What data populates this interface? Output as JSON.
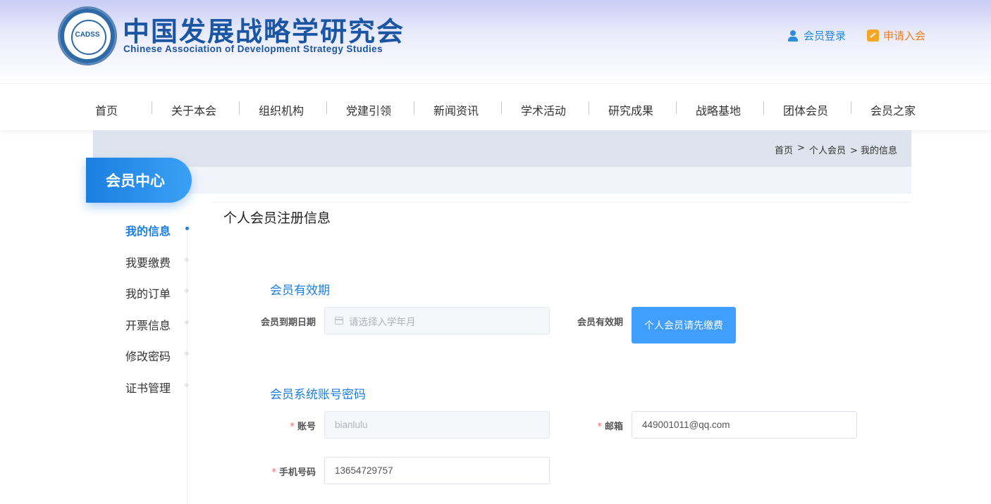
{
  "header": {
    "logo_text": "CADSS",
    "title": "中国发展战略学研究会",
    "subtitle": "Chinese Association of Development Strategy Studies",
    "login_label": "会员登录",
    "join_label": "申请入会"
  },
  "nav": {
    "items": [
      "首页",
      "关于本会",
      "组织机构",
      "党建引领",
      "新闻资讯",
      "学术活动",
      "研究成果",
      "战略基地",
      "团体会员",
      "会员之家"
    ]
  },
  "breadcrumb": {
    "items": [
      "首页",
      ">",
      "个人会员",
      "> 我的信息"
    ]
  },
  "sidebar": {
    "badge": "会员中心",
    "items": [
      "我的信息",
      "我要缴费",
      "我的订单",
      "开票信息",
      "修改密码",
      "证书管理"
    ],
    "active_index": 0
  },
  "main": {
    "page_title": "个人会员注册信息",
    "validity_section": {
      "title": "会员有效期",
      "expiry_label": "会员到期日期",
      "expiry_placeholder": "请选择入学年月",
      "validity_label": "会员有效期",
      "pay_button_label": "个人会员请先缴费"
    },
    "account_section": {
      "title": "会员系统账号密码",
      "account_label": "账号",
      "account_value": "bianlulu",
      "email_label": "邮箱",
      "email_value": "449001011@qq.com",
      "phone_label": "手机号码",
      "phone_value": "13654729757",
      "required_mark": "*"
    }
  },
  "colors": {
    "primary": "#1a7fe0",
    "button": "#409eff",
    "join": "#ef7d1a",
    "required": "#f56c6c"
  }
}
